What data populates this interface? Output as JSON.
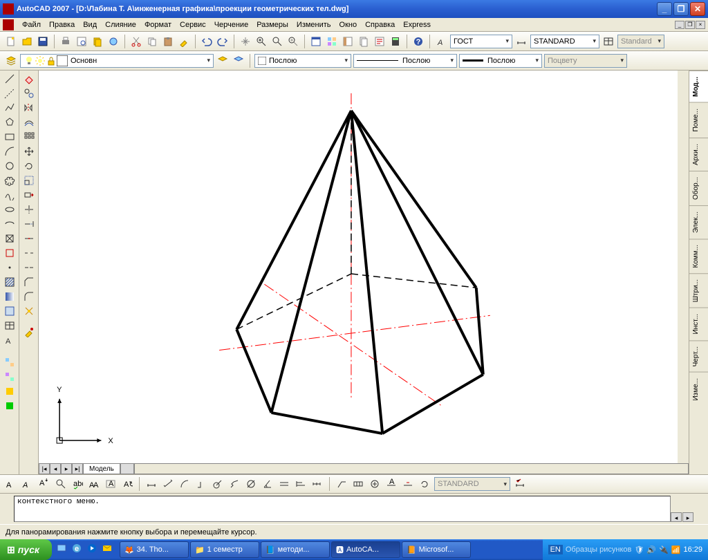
{
  "window": {
    "title": "AutoCAD 2007 - [D:\\Лабина Т. А\\инженерная графика\\проекции геометрических тел.dwg]"
  },
  "menu": {
    "items": [
      "Файл",
      "Правка",
      "Вид",
      "Слияние",
      "Формат",
      "Сервис",
      "Черчение",
      "Размеры",
      "Изменить",
      "Окно",
      "Справка",
      "Express"
    ]
  },
  "styles": {
    "textstyle_label": "ГОСТ",
    "dimstyle_label": "STANDARD",
    "tablestyle_label": "Standard"
  },
  "layers": {
    "current": "Основн"
  },
  "props": {
    "color": "Послою",
    "linetype": "Послою",
    "lineweight": "Послою",
    "plotstyle": "Поцвету"
  },
  "text_toolbar": {
    "style": "STANDARD"
  },
  "tabs": {
    "model": "Модель",
    "right": [
      "Мод...",
      "Поме...",
      "Архи...",
      "Обор...",
      "Элек...",
      "Комм...",
      "Штри...",
      "Инст...",
      "Черт...",
      "Изме..."
    ]
  },
  "command": {
    "text": "контекстного меню."
  },
  "status": {
    "text": "Для панорамирования нажмите кнопку выбора и перемещайте курсор."
  },
  "axes": {
    "x": "X",
    "y": "Y"
  },
  "taskbar": {
    "start": "пуск",
    "lang": "EN",
    "deskband": "Образцы рисунков",
    "clock": "16:29",
    "buttons": [
      "34. Tho...",
      "1 семестр",
      "методи...",
      "AutoCA...",
      "Microsof..."
    ]
  }
}
